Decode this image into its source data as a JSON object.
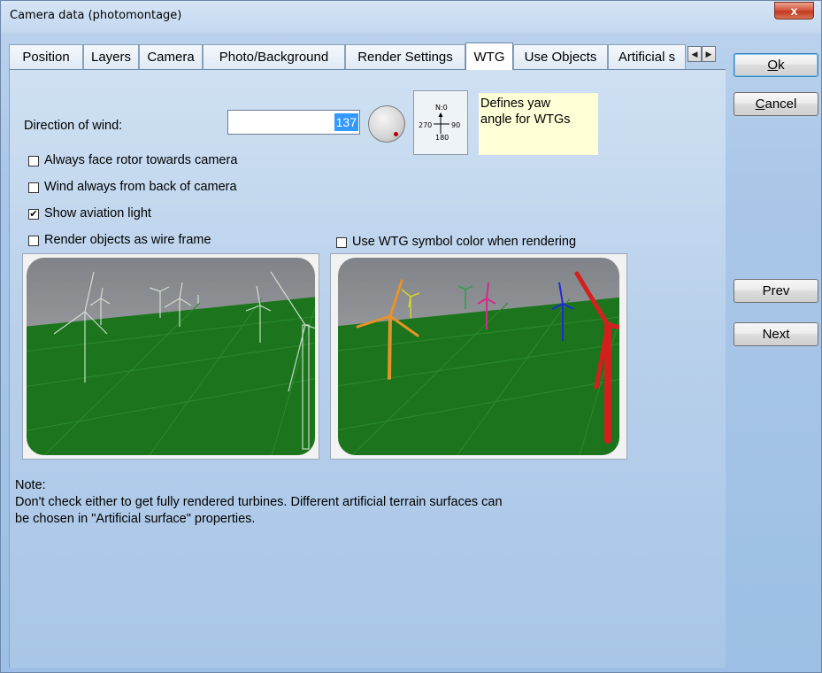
{
  "window": {
    "title": "Camera data  (photomontage)",
    "close_glyph": "x"
  },
  "tabs": [
    {
      "label": "Position",
      "active": false
    },
    {
      "label": "Layers",
      "active": false
    },
    {
      "label": "Camera",
      "active": false
    },
    {
      "label": "Photo/Background",
      "active": false
    },
    {
      "label": "Render Settings",
      "active": false
    },
    {
      "label": "WTG",
      "active": true
    },
    {
      "label": "Use Objects",
      "active": false
    },
    {
      "label": "Artificial s",
      "active": false
    }
  ],
  "tab_scroll": {
    "left_glyph": "◀",
    "right_glyph": "▶"
  },
  "wind": {
    "label": "Direction of wind:",
    "value": "137",
    "dial_icon": "wind-direction-dial-icon",
    "compass": {
      "n": "N:0",
      "e": "90",
      "s": "180",
      "w": "270"
    },
    "hint_line1": "Defines yaw",
    "hint_line2": "angle for WTGs"
  },
  "options": {
    "face_rotor": {
      "label": "Always face rotor towards camera",
      "checked": false
    },
    "wind_back": {
      "label": "Wind always from back of camera",
      "checked": false
    },
    "aviation_light": {
      "label": "Show aviation light",
      "checked": true
    },
    "wire_frame": {
      "label": "Render objects as wire frame",
      "checked": false
    },
    "symbol_color": {
      "label": "Use WTG symbol color when rendering",
      "checked": false
    }
  },
  "check_glyph": "✔",
  "note": {
    "heading": "Note:",
    "line1": "Don't check either to get fully rendered turbines. Different artificial terrain surfaces can",
    "line2": "be chosen in \"Artificial surface\" properties."
  },
  "buttons": {
    "ok_first": "O",
    "ok_rest": "k",
    "cancel_first": "C",
    "cancel_rest": "ancel",
    "prev": "Prev",
    "next": "Next"
  },
  "colors": {
    "ground": "#1f7a1f",
    "sky": "#a6a8ab",
    "turbine_orange": "#e8922a",
    "turbine_red": "#d41f1f",
    "turbine_blue": "#1f2ad4",
    "turbine_magenta": "#d42a8a",
    "turbine_yellow": "#d4d42a",
    "turbine_green": "#2ad44a"
  }
}
